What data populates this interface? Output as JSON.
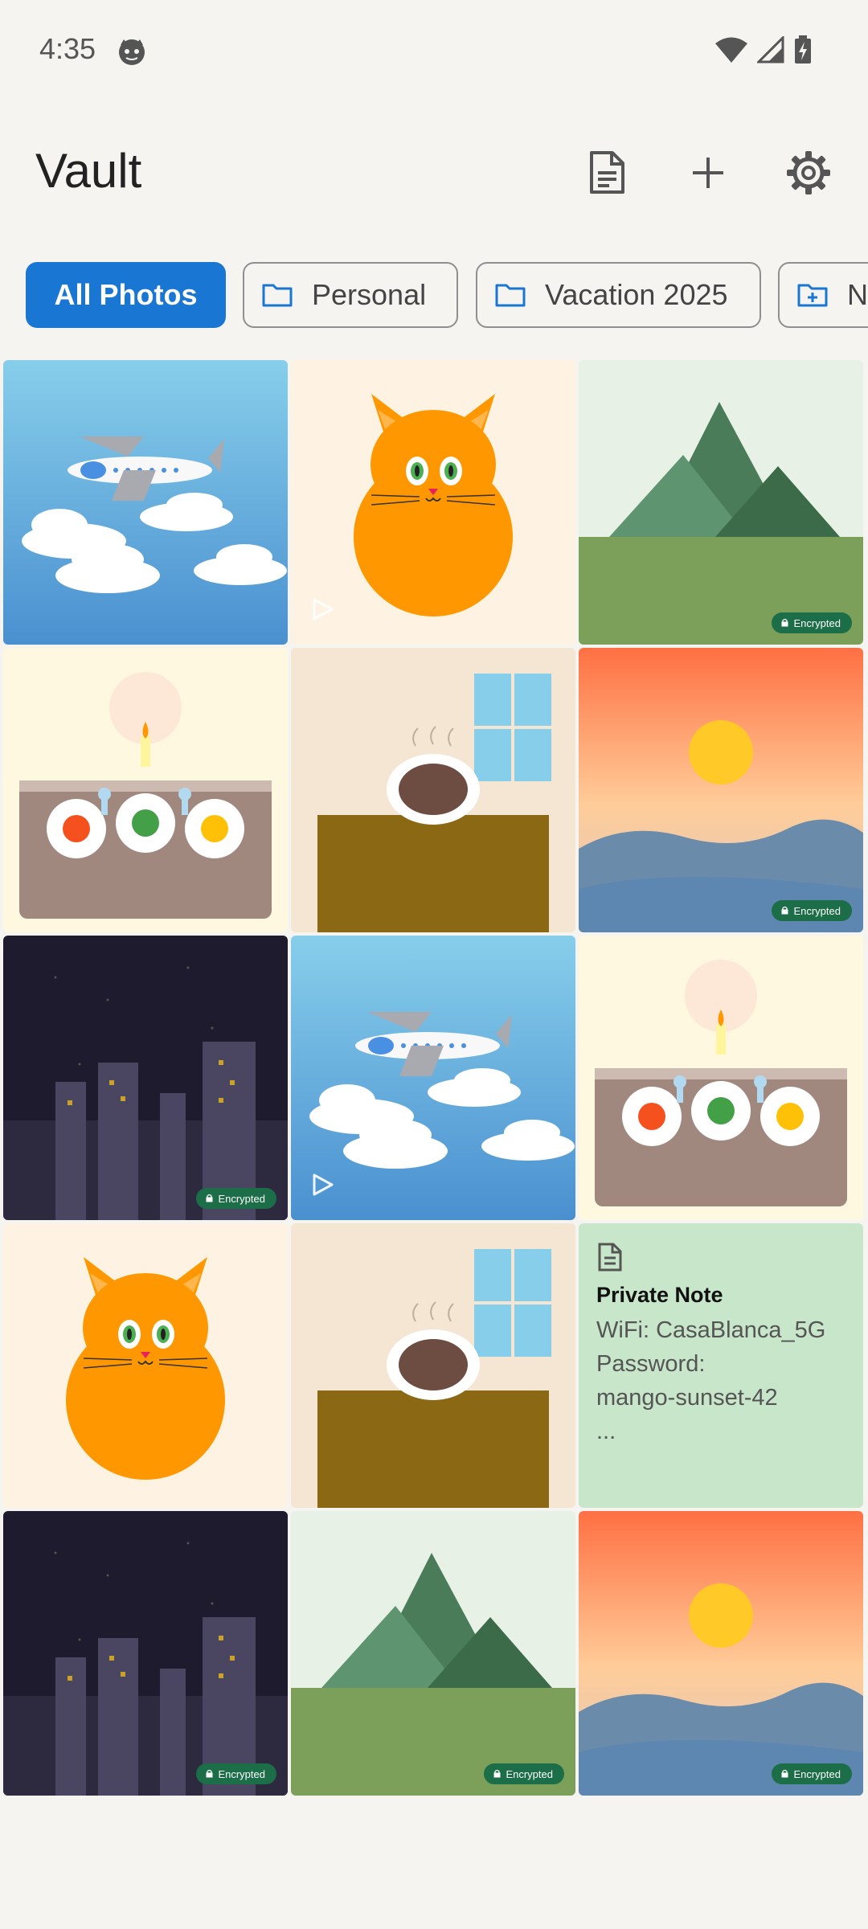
{
  "status_bar": {
    "time": "4:35"
  },
  "app_bar": {
    "title": "Vault",
    "actions": [
      "document-icon",
      "add-icon",
      "settings-icon"
    ]
  },
  "albums": [
    {
      "label": "All Photos",
      "selected": true
    },
    {
      "label": "Personal",
      "icon": "folder-icon"
    },
    {
      "label": "Vacation 2025",
      "icon": "folder-icon"
    },
    {
      "label": "Ne",
      "icon": "new-folder-icon"
    }
  ],
  "badge_text": "Encrypted",
  "grid": [
    {
      "image": "airplane",
      "encrypted": false,
      "video": false
    },
    {
      "image": "cat",
      "encrypted": false,
      "video": true
    },
    {
      "image": "mountains",
      "encrypted": true,
      "video": false
    },
    {
      "image": "cake",
      "encrypted": false,
      "video": false
    },
    {
      "image": "coffee",
      "encrypted": false,
      "video": false
    },
    {
      "image": "sunset",
      "encrypted": true,
      "video": false
    },
    {
      "image": "city-night",
      "encrypted": true,
      "video": false
    },
    {
      "image": "airplane",
      "encrypted": false,
      "video": true
    },
    {
      "image": "cake",
      "encrypted": false,
      "video": false
    },
    {
      "image": "cat",
      "encrypted": false,
      "video": false
    },
    {
      "image": "coffee",
      "encrypted": false,
      "video": false
    },
    {
      "image": "note",
      "encrypted": false,
      "video": false
    },
    {
      "image": "city-night",
      "encrypted": true,
      "video": false
    },
    {
      "image": "mountains",
      "encrypted": true,
      "video": false
    },
    {
      "image": "sunset",
      "encrypted": true,
      "video": false
    }
  ],
  "note": {
    "title": "Private Note",
    "body": "WiFi: CasaBlanca_5G\nPassword:\nmango-sunset-42\n..."
  },
  "colors": {
    "accent": "#1976D2",
    "badge": "#1B6E47",
    "note_bg": "#C8E6C9",
    "background": "#F6F4F0"
  }
}
